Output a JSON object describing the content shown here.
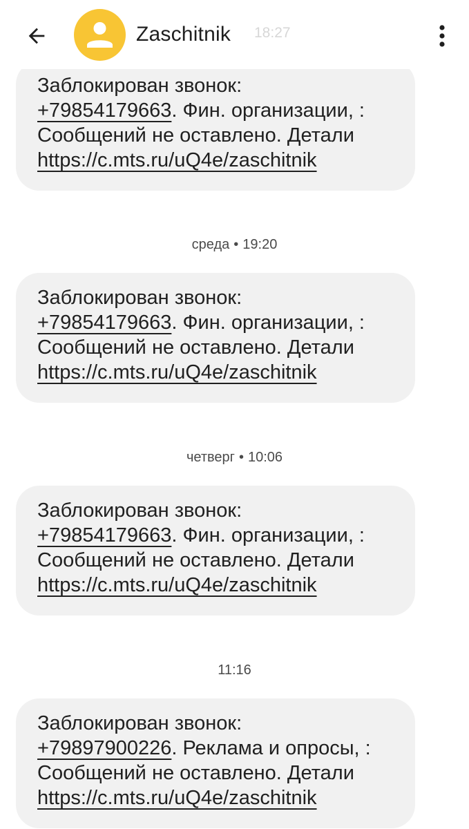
{
  "header": {
    "contact_name": "Zaschitnik",
    "partial_time": "18:27",
    "back_icon": "arrow-left-icon",
    "avatar_icon": "person-icon",
    "more_icon": "more-vert-icon",
    "avatar_color": "#f8c534"
  },
  "messages": [
    {
      "line1": "Заблокирован звонок:",
      "phone": "+79854179663",
      "line2_rest": ". Фин. организации, :",
      "line3": "Сообщений не оставлено. Детали",
      "link": "https://c.mts.ru/uQ4e/zaschitnik"
    },
    {
      "stamp_day": "среда",
      "stamp_time": "19:20",
      "line1": "Заблокирован звонок:",
      "phone": "+79854179663",
      "line2_rest": ". Фин. организации, :",
      "line3": "Сообщений не оставлено. Детали",
      "link": "https://c.mts.ru/uQ4e/zaschitnik"
    },
    {
      "stamp_day": "четверг",
      "stamp_time": "10:06",
      "line1": "Заблокирован звонок:",
      "phone": "+79854179663",
      "line2_rest": ". Фин. организации, :",
      "line3": "Сообщений не оставлено. Детали",
      "link": "https://c.mts.ru/uQ4e/zaschitnik"
    },
    {
      "stamp_time": "11:16",
      "line1": "Заблокирован звонок:",
      "phone": "+79897900226",
      "line2_rest": ". Реклама и опросы, :",
      "line3": "Сообщений не оставлено. Детали",
      "link": "https://c.mts.ru/uQ4e/zaschitnik"
    }
  ],
  "stamp_separator": "•",
  "colors": {
    "bubble_bg": "#f1f1f1",
    "text": "#202020",
    "stamp_text": "#4a4a4a"
  }
}
